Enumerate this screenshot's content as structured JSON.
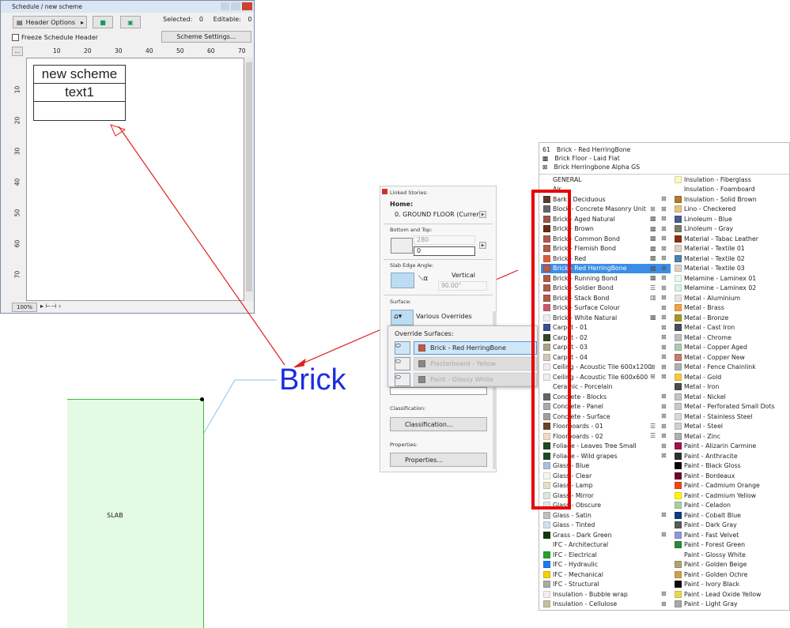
{
  "schedule": {
    "title": "Schedule / new scheme",
    "header_options": "Header Options",
    "selected_label": "Selected:",
    "selected_value": "0",
    "editable_label": "Editable:",
    "editable_value": "0",
    "freeze_label": "Freeze Schedule Header",
    "scheme_settings": "Scheme Settings...",
    "ruler_more": "...",
    "ruler_h": [
      "10",
      "20",
      "30",
      "40",
      "50",
      "60",
      "70"
    ],
    "ruler_v": [
      "10",
      "20",
      "30",
      "40",
      "50",
      "60",
      "70"
    ],
    "table": {
      "title": "new scheme",
      "header": "text1"
    },
    "zoom": "100%"
  },
  "annotation": {
    "label": "Brick",
    "slab_label": "SLAB",
    "arrow_color": "#e02020",
    "label_color": "#1a2ee0"
  },
  "panel": {
    "linked_stories": "Linked Stories:",
    "home": "Home:",
    "home_value": "0. GROUND FLOOR (Current)",
    "bottom_top": "Bottom and Top:",
    "top_value": "280",
    "bottom_value": "0",
    "edge_angle": "Slab Edge Angle:",
    "vertical": "Vertical",
    "angle_value": "90.00°",
    "surface": "Surface:",
    "surface_value": "Various Overrides",
    "classification_label": "Classification:",
    "classification_btn": "Classification...",
    "properties_label": "Properties:",
    "properties_btn": "Properties..."
  },
  "override": {
    "title": "Override Surfaces:",
    "items": [
      {
        "label": "Brick - Red HerringBone",
        "color": "#b85a4e",
        "active": true
      },
      {
        "label": "Plasterboard - Yellow",
        "color": "#888888",
        "active": false
      },
      {
        "label": "Paint - Glossy White",
        "color": "#888888",
        "active": false
      }
    ]
  },
  "materials": {
    "header": {
      "index": "61",
      "name": "Brick - Red HerringBone",
      "fill": "Brick Floor - Laid Flat",
      "texture": "Brick Herringbone Alpha GS"
    },
    "selected": "Brick - Red HerringBone",
    "left": [
      [
        "GENERAL",
        ""
      ],
      [
        "Air",
        ""
      ],
      [
        "Bark - Deciduous",
        "#5a3a2e"
      ],
      [
        "Block - Concrete Masonry Unit",
        "#666666"
      ],
      [
        "Brick - Aged Natural",
        "#a05444"
      ],
      [
        "Brick - Brown",
        "#6a2a14"
      ],
      [
        "Brick - Common Bond",
        "#b05a48"
      ],
      [
        "Brick - Flemish Bond",
        "#b05a48"
      ],
      [
        "Brick - Red",
        "#d8603c"
      ],
      [
        "Brick - Red HerringBone",
        "#b85a4e"
      ],
      [
        "Brick - Running Bond",
        "#b05a48"
      ],
      [
        "Brick - Soldier Bond",
        "#b05a48"
      ],
      [
        "Brick - Stack Bond",
        "#b05a48"
      ],
      [
        "Brick - Surface Colour",
        "#c85a68"
      ],
      [
        "Brick - White Natural",
        "#eeeeee"
      ],
      [
        "Carpet - 01",
        "#3a4e94"
      ],
      [
        "Carpet - 02",
        "#2e4a24"
      ],
      [
        "Carpet - 03",
        "#a8a48c"
      ],
      [
        "Carpet - 04",
        "#cfc8b4"
      ],
      [
        "Ceiling - Acoustic Tile 600x1200",
        "#eeeeee"
      ],
      [
        "Ceiling - Acoustic Tile 600x600",
        "#eeeeee"
      ],
      [
        "Ceramic - Porcelain",
        ""
      ],
      [
        "Concrete - Blocks",
        "#666666"
      ],
      [
        "Concrete - Panel",
        "#aaaaaa"
      ],
      [
        "Concrete - Surface",
        "#a0a0a0"
      ],
      [
        "Floorboards - 01",
        "#6a4424"
      ],
      [
        "Floorboards - 02",
        "#f0dcc4"
      ],
      [
        "Foliage - Leaves Tree Small",
        "#1e4a20"
      ],
      [
        "Foliage - Wild grapes",
        "#1e4a20"
      ],
      [
        "Glass - Blue",
        "#a8c0dc"
      ],
      [
        "Glass - Clear",
        "#f4f6f4"
      ],
      [
        "Glass - Lamp",
        "#e4e0c8"
      ],
      [
        "Glass - Mirror",
        "#dce8dc"
      ],
      [
        "Glass - Obscure",
        "#e4e4e4"
      ],
      [
        "Glass - Satin",
        "#c0c0c0"
      ],
      [
        "Glass - Tinted",
        "#d4e0ec"
      ],
      [
        "Grass - Dark Green",
        "#0e3a0e"
      ],
      [
        "IFC - Architectural",
        ""
      ],
      [
        "IFC - Electrical",
        "#2aa02a"
      ],
      [
        "IFC - Hydraulic",
        "#1a7cf0"
      ],
      [
        "IFC - Mechanical",
        "#f8d000"
      ],
      [
        "IFC - Structural",
        "#aaaaaa"
      ],
      [
        "Insulation - Bubble wrap",
        "#f0f0f0"
      ],
      [
        "Insulation - Cellulose",
        "#c4c0a0"
      ]
    ],
    "right": [
      [
        "Insulation - Fiberglass",
        "#fafac0"
      ],
      [
        "Insulation - Foamboard",
        ""
      ],
      [
        "Insulation - Solid Brown",
        "#b07a30"
      ],
      [
        "Lino - Checkered",
        "#e8c080"
      ],
      [
        "Linoleum - Blue",
        "#4a5c94"
      ],
      [
        "Linoleum - Gray",
        "#7a7a64"
      ],
      [
        "Material - Tabac Leather",
        "#8a3010"
      ],
      [
        "Material - Textile 01",
        "#dcd0c8"
      ],
      [
        "Material - Textile 02",
        "#4a84b0"
      ],
      [
        "Material - Textile 03",
        "#dcd0c8"
      ],
      [
        "Melamine - Laminex 01",
        "#e8f8ec"
      ],
      [
        "Melamine - Laminex 02",
        "#d8f4dc"
      ],
      [
        "Metal - Aluminium",
        "#e8e4e4"
      ],
      [
        "Metal - Brass",
        "#f4a040"
      ],
      [
        "Metal - Bronze",
        "#a89428"
      ],
      [
        "Metal - Cast Iron",
        "#4a4e58"
      ],
      [
        "Metal - Chrome",
        "#c0c0c0"
      ],
      [
        "Metal - Copper Aged",
        "#a8ccb0"
      ],
      [
        "Metal - Copper New",
        "#c47c6c"
      ],
      [
        "Metal - Fence Chainlink",
        "#b0b0b0"
      ],
      [
        "Metal - Gold",
        "#f8c840"
      ],
      [
        "Metal - Iron",
        "#4a4c54"
      ],
      [
        "Metal - Nickel",
        "#c4c4c4"
      ],
      [
        "Metal - Perforated Small Dots",
        "#c8c8c8"
      ],
      [
        "Metal - Stainless Steel",
        "#d8d8d8"
      ],
      [
        "Metal - Steel",
        "#d0d0d0"
      ],
      [
        "Metal - Zinc",
        "#b0b0b0"
      ],
      [
        "Paint - Alizarin Carmine",
        "#a0104c"
      ],
      [
        "Paint - Anthracite",
        "#2c2e30"
      ],
      [
        "Paint - Black Gloss",
        "#080808"
      ],
      [
        "Paint - Bordeaux",
        "#6c0830"
      ],
      [
        "Paint - Cadmium Orange",
        "#f04818"
      ],
      [
        "Paint - Cadmium Yellow",
        "#fff800"
      ],
      [
        "Paint - Celadon",
        "#a8d0a8"
      ],
      [
        "Paint - Cobalt Blue",
        "#0c3c80"
      ],
      [
        "Paint - Dark Gray",
        "#5a5a5a"
      ],
      [
        "Paint - Fast Velvet",
        "#9098d8"
      ],
      [
        "Paint - Forest Green",
        "#2a8a3a"
      ],
      [
        "Paint - Glossy White",
        ""
      ],
      [
        "Paint - Golden Beige",
        "#b0a474"
      ],
      [
        "Paint - Golden Ochre",
        "#d0a050"
      ],
      [
        "Paint - Ivory Black",
        "#0a0a0a"
      ],
      [
        "Paint - Lead Oxide Yellow",
        "#e8d850"
      ],
      [
        "Paint - Light Gray",
        "#a8a8a8"
      ]
    ]
  }
}
